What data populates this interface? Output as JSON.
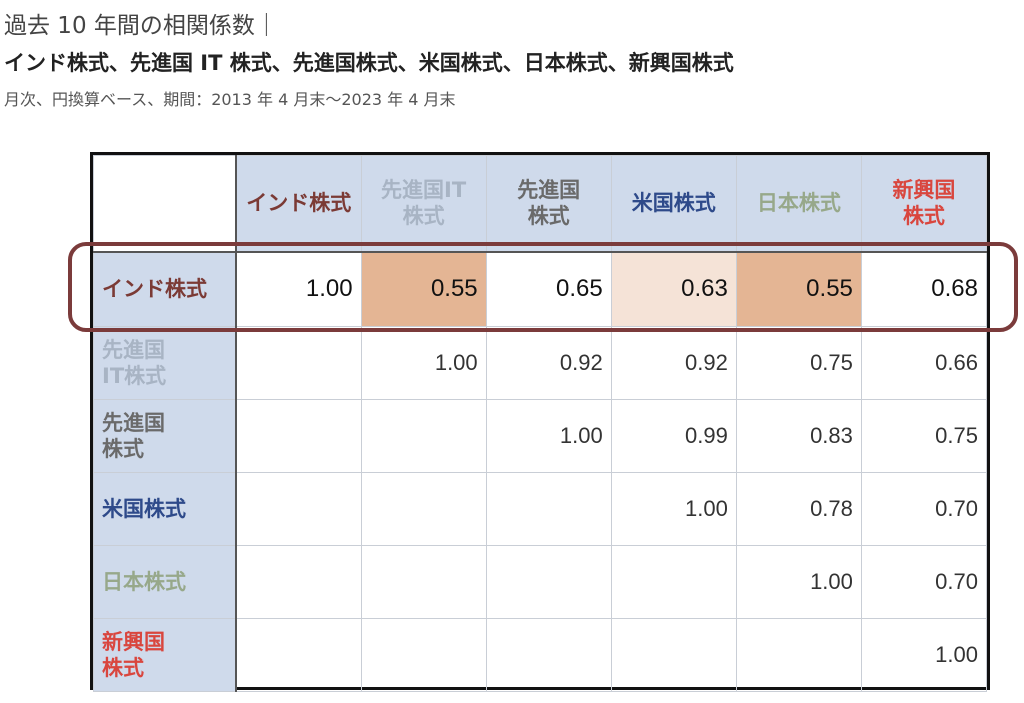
{
  "title": "過去 10 年間の相関係数｜",
  "subtitle": "インド株式、先進国 IT 株式、先進国株式、米国株式、日本株式、新興国株式",
  "note": "月次、円換算ベース、期間：2013 年 4 月末～2023 年 4 月末",
  "chart_data": {
    "type": "table",
    "headers": [
      {
        "label": "インド株式",
        "color": "#7b3a35"
      },
      {
        "label": "先進国IT\n株式",
        "color": "#a8b4c4"
      },
      {
        "label": "先進国\n株式",
        "color": "#6a6a6a"
      },
      {
        "label": "米国株式",
        "color": "#2e4a8a"
      },
      {
        "label": "日本株式",
        "color": "#97a88a"
      },
      {
        "label": "新興国\n株式",
        "color": "#d9463e"
      }
    ],
    "rows": [
      {
        "label": "インド株式",
        "values": [
          "1.00",
          "0.55",
          "0.65",
          "0.63",
          "0.55",
          "0.68"
        ],
        "fills": [
          "#ffffff",
          "#e4b594",
          "#ffffff",
          "#f5e3d7",
          "#e4b594",
          "#ffffff"
        ]
      },
      {
        "label": "先進国\nIT株式",
        "values": [
          "",
          "1.00",
          "0.92",
          "0.92",
          "0.75",
          "0.66"
        ]
      },
      {
        "label": "先進国\n株式",
        "values": [
          "",
          "",
          "1.00",
          "0.99",
          "0.83",
          "0.75"
        ]
      },
      {
        "label": "米国株式",
        "values": [
          "",
          "",
          "",
          "1.00",
          "0.78",
          "0.70"
        ]
      },
      {
        "label": "日本株式",
        "values": [
          "",
          "",
          "",
          "",
          "1.00",
          "0.70"
        ]
      },
      {
        "label": "新興国\n株式",
        "values": [
          "",
          "",
          "",
          "",
          "",
          "1.00"
        ]
      }
    ],
    "highlighted_row": "インド株式",
    "highlight_color": "#7b3b3b"
  }
}
